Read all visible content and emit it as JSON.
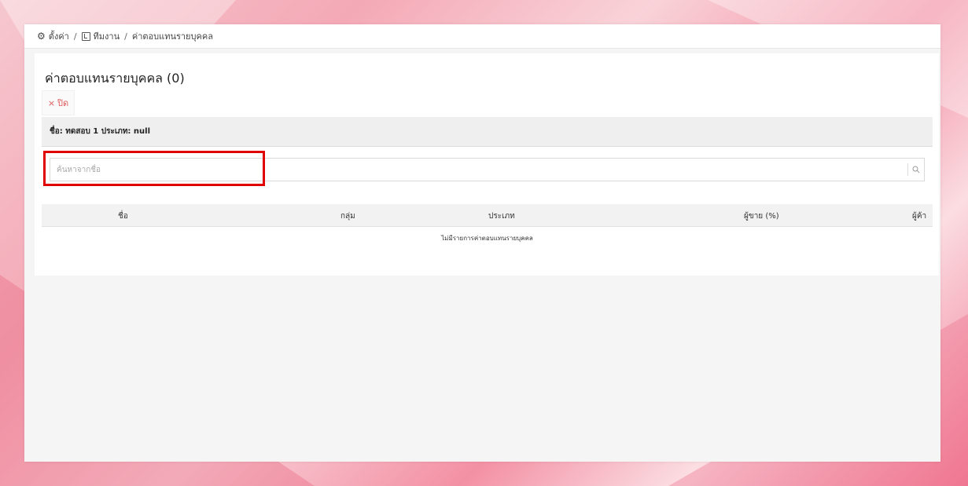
{
  "breadcrumb": {
    "settings_icon": "gear-icon",
    "settings_label": "ตั้งค่า",
    "team_icon": "box-icon",
    "team_label": "ทีมงาน",
    "current_label": "ค่าตอบแทนรายบุคคล",
    "separator": "/"
  },
  "page": {
    "title": "ค่าตอบแทนรายบุคคล (0)",
    "close_label": "ปิด",
    "close_icon": "×"
  },
  "info": {
    "text": "ชื่อ: ทดสอบ 1 ประเภท: null"
  },
  "search": {
    "placeholder": "ค้นหาจากชื่อ",
    "value": "",
    "icon": "search-icon"
  },
  "table": {
    "columns": [
      "ชื่อ",
      "กลุ่ม",
      "ประเภท",
      "ผู้ขาย (%)",
      "ผู้ค้า"
    ],
    "empty_text": "ไม่มีรายการค่าตอบแทนรายบุคคล"
  },
  "colors": {
    "close": "#e05a5a",
    "highlight": "#e00000"
  }
}
